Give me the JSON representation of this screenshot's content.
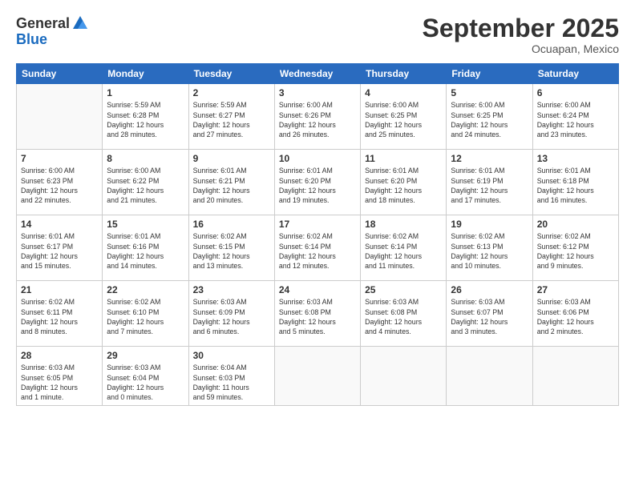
{
  "logo": {
    "general": "General",
    "blue": "Blue"
  },
  "header": {
    "month": "September 2025",
    "location": "Ocuapan, Mexico"
  },
  "weekdays": [
    "Sunday",
    "Monday",
    "Tuesday",
    "Wednesday",
    "Thursday",
    "Friday",
    "Saturday"
  ],
  "weeks": [
    [
      {
        "day": "",
        "info": ""
      },
      {
        "day": "1",
        "info": "Sunrise: 5:59 AM\nSunset: 6:28 PM\nDaylight: 12 hours\nand 28 minutes."
      },
      {
        "day": "2",
        "info": "Sunrise: 5:59 AM\nSunset: 6:27 PM\nDaylight: 12 hours\nand 27 minutes."
      },
      {
        "day": "3",
        "info": "Sunrise: 6:00 AM\nSunset: 6:26 PM\nDaylight: 12 hours\nand 26 minutes."
      },
      {
        "day": "4",
        "info": "Sunrise: 6:00 AM\nSunset: 6:25 PM\nDaylight: 12 hours\nand 25 minutes."
      },
      {
        "day": "5",
        "info": "Sunrise: 6:00 AM\nSunset: 6:25 PM\nDaylight: 12 hours\nand 24 minutes."
      },
      {
        "day": "6",
        "info": "Sunrise: 6:00 AM\nSunset: 6:24 PM\nDaylight: 12 hours\nand 23 minutes."
      }
    ],
    [
      {
        "day": "7",
        "info": "Sunrise: 6:00 AM\nSunset: 6:23 PM\nDaylight: 12 hours\nand 22 minutes."
      },
      {
        "day": "8",
        "info": "Sunrise: 6:00 AM\nSunset: 6:22 PM\nDaylight: 12 hours\nand 21 minutes."
      },
      {
        "day": "9",
        "info": "Sunrise: 6:01 AM\nSunset: 6:21 PM\nDaylight: 12 hours\nand 20 minutes."
      },
      {
        "day": "10",
        "info": "Sunrise: 6:01 AM\nSunset: 6:20 PM\nDaylight: 12 hours\nand 19 minutes."
      },
      {
        "day": "11",
        "info": "Sunrise: 6:01 AM\nSunset: 6:20 PM\nDaylight: 12 hours\nand 18 minutes."
      },
      {
        "day": "12",
        "info": "Sunrise: 6:01 AM\nSunset: 6:19 PM\nDaylight: 12 hours\nand 17 minutes."
      },
      {
        "day": "13",
        "info": "Sunrise: 6:01 AM\nSunset: 6:18 PM\nDaylight: 12 hours\nand 16 minutes."
      }
    ],
    [
      {
        "day": "14",
        "info": "Sunrise: 6:01 AM\nSunset: 6:17 PM\nDaylight: 12 hours\nand 15 minutes."
      },
      {
        "day": "15",
        "info": "Sunrise: 6:01 AM\nSunset: 6:16 PM\nDaylight: 12 hours\nand 14 minutes."
      },
      {
        "day": "16",
        "info": "Sunrise: 6:02 AM\nSunset: 6:15 PM\nDaylight: 12 hours\nand 13 minutes."
      },
      {
        "day": "17",
        "info": "Sunrise: 6:02 AM\nSunset: 6:14 PM\nDaylight: 12 hours\nand 12 minutes."
      },
      {
        "day": "18",
        "info": "Sunrise: 6:02 AM\nSunset: 6:14 PM\nDaylight: 12 hours\nand 11 minutes."
      },
      {
        "day": "19",
        "info": "Sunrise: 6:02 AM\nSunset: 6:13 PM\nDaylight: 12 hours\nand 10 minutes."
      },
      {
        "day": "20",
        "info": "Sunrise: 6:02 AM\nSunset: 6:12 PM\nDaylight: 12 hours\nand 9 minutes."
      }
    ],
    [
      {
        "day": "21",
        "info": "Sunrise: 6:02 AM\nSunset: 6:11 PM\nDaylight: 12 hours\nand 8 minutes."
      },
      {
        "day": "22",
        "info": "Sunrise: 6:02 AM\nSunset: 6:10 PM\nDaylight: 12 hours\nand 7 minutes."
      },
      {
        "day": "23",
        "info": "Sunrise: 6:03 AM\nSunset: 6:09 PM\nDaylight: 12 hours\nand 6 minutes."
      },
      {
        "day": "24",
        "info": "Sunrise: 6:03 AM\nSunset: 6:08 PM\nDaylight: 12 hours\nand 5 minutes."
      },
      {
        "day": "25",
        "info": "Sunrise: 6:03 AM\nSunset: 6:08 PM\nDaylight: 12 hours\nand 4 minutes."
      },
      {
        "day": "26",
        "info": "Sunrise: 6:03 AM\nSunset: 6:07 PM\nDaylight: 12 hours\nand 3 minutes."
      },
      {
        "day": "27",
        "info": "Sunrise: 6:03 AM\nSunset: 6:06 PM\nDaylight: 12 hours\nand 2 minutes."
      }
    ],
    [
      {
        "day": "28",
        "info": "Sunrise: 6:03 AM\nSunset: 6:05 PM\nDaylight: 12 hours\nand 1 minute."
      },
      {
        "day": "29",
        "info": "Sunrise: 6:03 AM\nSunset: 6:04 PM\nDaylight: 12 hours\nand 0 minutes."
      },
      {
        "day": "30",
        "info": "Sunrise: 6:04 AM\nSunset: 6:03 PM\nDaylight: 11 hours\nand 59 minutes."
      },
      {
        "day": "",
        "info": ""
      },
      {
        "day": "",
        "info": ""
      },
      {
        "day": "",
        "info": ""
      },
      {
        "day": "",
        "info": ""
      }
    ]
  ]
}
